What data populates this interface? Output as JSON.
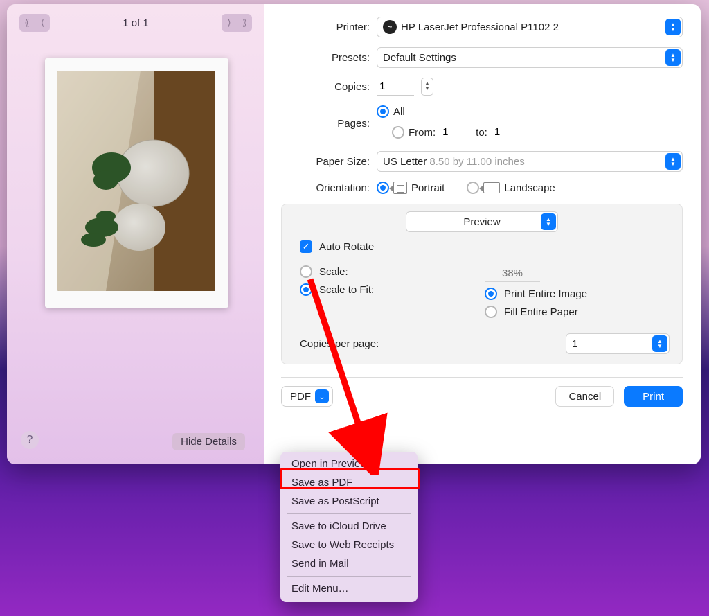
{
  "nav": {
    "page_counter": "1 of 1"
  },
  "hide_details": "Hide Details",
  "help_glyph": "?",
  "printer": {
    "label": "Printer:",
    "value": "HP LaserJet Professional P1102 2"
  },
  "presets": {
    "label": "Presets:",
    "value": "Default Settings"
  },
  "copies": {
    "label": "Copies:",
    "value": "1"
  },
  "pages": {
    "label": "Pages:",
    "all": "All",
    "from_label": "From:",
    "from_value": "1",
    "to_label": "to:",
    "to_value": "1"
  },
  "paper_size": {
    "label": "Paper Size:",
    "value": "US Letter",
    "hint": "8.50 by 11.00 inches"
  },
  "orientation": {
    "label": "Orientation:",
    "portrait": "Portrait",
    "landscape": "Landscape"
  },
  "panel": {
    "app_select": "Preview",
    "auto_rotate": "Auto Rotate",
    "scale": "Scale:",
    "scale_value": "38%",
    "scale_to_fit": "Scale to Fit:",
    "print_entire": "Print Entire Image",
    "fill_paper": "Fill Entire Paper",
    "cpp_label": "Copies per page:",
    "cpp_value": "1"
  },
  "pdf_button": "PDF",
  "cancel": "Cancel",
  "print": "Print",
  "menu": {
    "open_preview": "Open in Preview",
    "save_pdf": "Save as PDF",
    "save_ps": "Save as PostScript",
    "icloud": "Save to iCloud Drive",
    "web_receipts": "Save to Web Receipts",
    "mail": "Send in Mail",
    "edit": "Edit Menu…"
  }
}
